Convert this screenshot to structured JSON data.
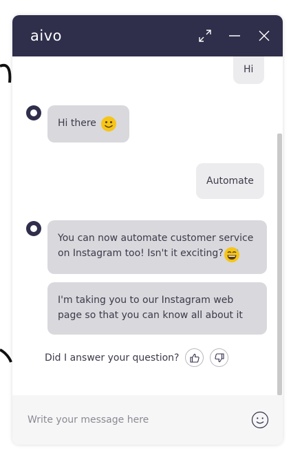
{
  "header": {
    "logo_text": "aivo",
    "background": "#2f2e4b"
  },
  "icons": {
    "expand": "expand-arrows-icon",
    "minimize": "minimize-icon",
    "close": "close-icon",
    "avatar": "bot-avatar-icon",
    "smile": "smile-emoji-icon",
    "grin": "grinning-sweat-emoji-icon",
    "thumbs_up": "thumbs-up-icon",
    "thumbs_down": "thumbs-down-icon",
    "emoji_picker": "emoji-icon"
  },
  "messages": [
    {
      "sender": "user",
      "text": "Hi"
    },
    {
      "sender": "bot",
      "text": "Hi there"
    },
    {
      "sender": "user",
      "text": "Automate"
    },
    {
      "sender": "bot",
      "text": "You can now automate customer service on Instagram too! Isn't it exciting?"
    },
    {
      "sender": "bot",
      "text": "I'm taking you to our Instagram web page so that you can know all about it"
    }
  ],
  "feedback": {
    "question": "Did I answer your question?"
  },
  "composer": {
    "placeholder": "Write your message here",
    "value": ""
  },
  "colors": {
    "bot_bubble": "#d9d8dd",
    "user_bubble": "#ececee",
    "text": "#3b3a4a",
    "emoji_yellow": "#f5c518"
  }
}
